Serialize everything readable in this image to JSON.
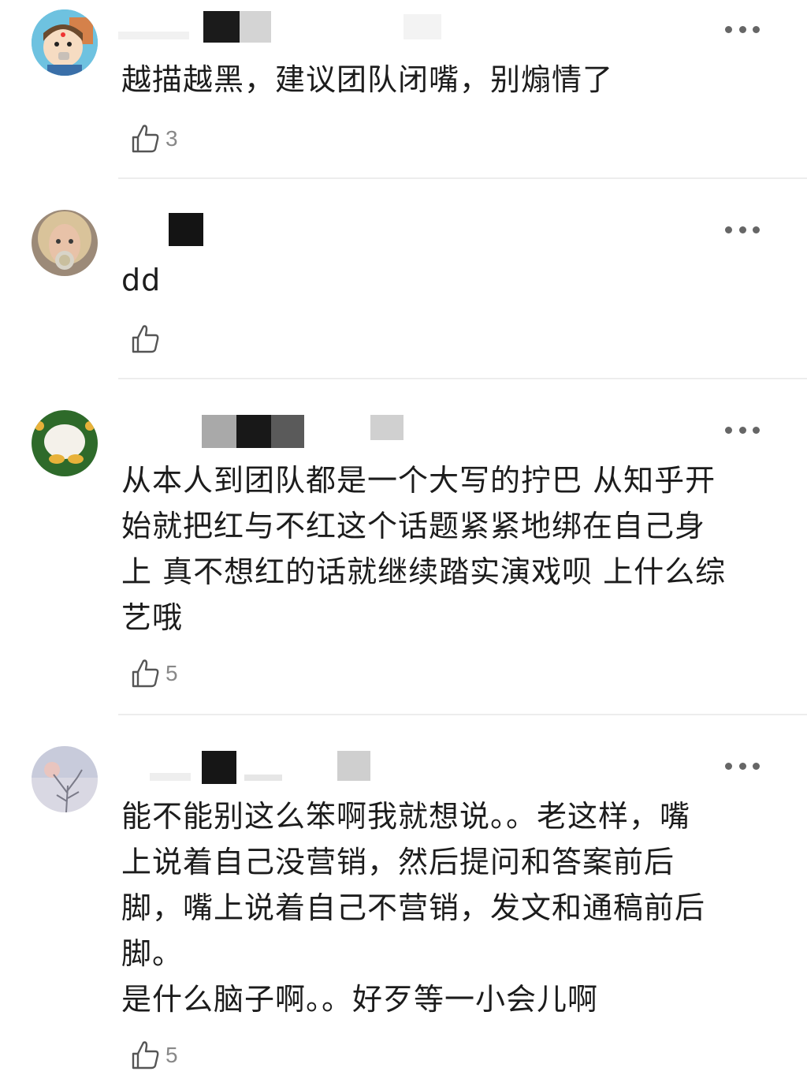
{
  "comments": [
    {
      "avatar": "cartoon-face-avatar",
      "text": "越描越黑，建议团队闭嘴，别煽情了",
      "likes": "3"
    },
    {
      "avatar": "woman-photo-avatar",
      "text": "dd",
      "likes": ""
    },
    {
      "avatar": "white-object-green-avatar",
      "text": "从本人到团队都是一个大写的拧巴 从知乎开\n始就把红与不红这个话题紧紧地绑在自己身\n上 真不想红的话就继续踏实演戏呗 上什么综\n艺哦",
      "likes": "5"
    },
    {
      "avatar": "winter-tree-avatar",
      "text": "能不能别这么笨啊我就想说。。老这样，嘴\n上说着自己没营销，然后提问和答案前后\n脚，嘴上说着自己不营销，发文和通稿前后\n脚。\n是什么脑子啊。。好歹等一小会儿啊",
      "likes": "5"
    }
  ],
  "icons": {
    "more": "more-dots-icon",
    "like": "thumbs-up-icon"
  },
  "colors": {
    "text": "#1c1c1c",
    "count": "#888888",
    "divider": "#ededed",
    "icon": "#666666"
  }
}
